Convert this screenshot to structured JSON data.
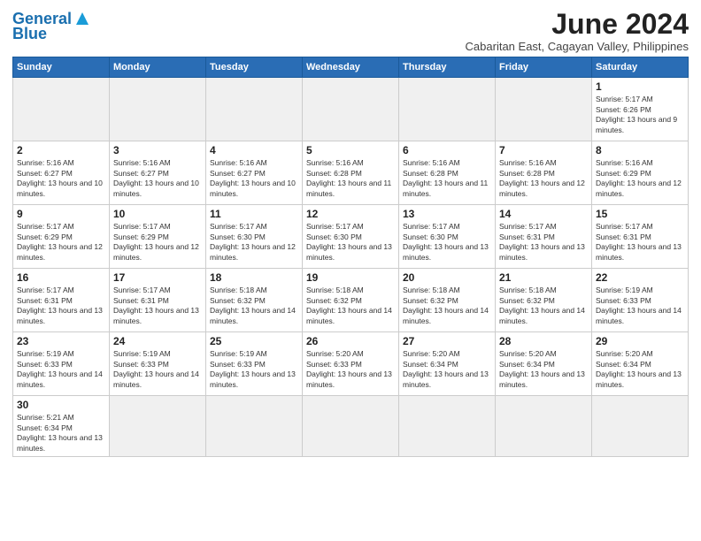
{
  "logo": {
    "text_general": "General",
    "text_blue": "Blue"
  },
  "title": {
    "month_year": "June 2024",
    "location": "Cabaritan East, Cagayan Valley, Philippines"
  },
  "days_of_week": [
    "Sunday",
    "Monday",
    "Tuesday",
    "Wednesday",
    "Thursday",
    "Friday",
    "Saturday"
  ],
  "weeks": [
    [
      {
        "day": "",
        "empty": true
      },
      {
        "day": "",
        "empty": true
      },
      {
        "day": "",
        "empty": true
      },
      {
        "day": "",
        "empty": true
      },
      {
        "day": "",
        "empty": true
      },
      {
        "day": "",
        "empty": true
      },
      {
        "day": "1",
        "sunrise": "5:17 AM",
        "sunset": "6:26 PM",
        "daylight": "13 hours and 9 minutes."
      }
    ],
    [
      {
        "day": "2",
        "sunrise": "5:16 AM",
        "sunset": "6:27 PM",
        "daylight": "13 hours and 10 minutes."
      },
      {
        "day": "3",
        "sunrise": "5:16 AM",
        "sunset": "6:27 PM",
        "daylight": "13 hours and 10 minutes."
      },
      {
        "day": "4",
        "sunrise": "5:16 AM",
        "sunset": "6:27 PM",
        "daylight": "13 hours and 10 minutes."
      },
      {
        "day": "5",
        "sunrise": "5:16 AM",
        "sunset": "6:28 PM",
        "daylight": "13 hours and 11 minutes."
      },
      {
        "day": "6",
        "sunrise": "5:16 AM",
        "sunset": "6:28 PM",
        "daylight": "13 hours and 11 minutes."
      },
      {
        "day": "7",
        "sunrise": "5:16 AM",
        "sunset": "6:28 PM",
        "daylight": "13 hours and 12 minutes."
      },
      {
        "day": "8",
        "sunrise": "5:16 AM",
        "sunset": "6:29 PM",
        "daylight": "13 hours and 12 minutes."
      }
    ],
    [
      {
        "day": "9",
        "sunrise": "5:17 AM",
        "sunset": "6:29 PM",
        "daylight": "13 hours and 12 minutes."
      },
      {
        "day": "10",
        "sunrise": "5:17 AM",
        "sunset": "6:29 PM",
        "daylight": "13 hours and 12 minutes."
      },
      {
        "day": "11",
        "sunrise": "5:17 AM",
        "sunset": "6:30 PM",
        "daylight": "13 hours and 12 minutes."
      },
      {
        "day": "12",
        "sunrise": "5:17 AM",
        "sunset": "6:30 PM",
        "daylight": "13 hours and 13 minutes."
      },
      {
        "day": "13",
        "sunrise": "5:17 AM",
        "sunset": "6:30 PM",
        "daylight": "13 hours and 13 minutes."
      },
      {
        "day": "14",
        "sunrise": "5:17 AM",
        "sunset": "6:31 PM",
        "daylight": "13 hours and 13 minutes."
      },
      {
        "day": "15",
        "sunrise": "5:17 AM",
        "sunset": "6:31 PM",
        "daylight": "13 hours and 13 minutes."
      }
    ],
    [
      {
        "day": "16",
        "sunrise": "5:17 AM",
        "sunset": "6:31 PM",
        "daylight": "13 hours and 13 minutes."
      },
      {
        "day": "17",
        "sunrise": "5:17 AM",
        "sunset": "6:31 PM",
        "daylight": "13 hours and 13 minutes."
      },
      {
        "day": "18",
        "sunrise": "5:18 AM",
        "sunset": "6:32 PM",
        "daylight": "13 hours and 14 minutes."
      },
      {
        "day": "19",
        "sunrise": "5:18 AM",
        "sunset": "6:32 PM",
        "daylight": "13 hours and 14 minutes."
      },
      {
        "day": "20",
        "sunrise": "5:18 AM",
        "sunset": "6:32 PM",
        "daylight": "13 hours and 14 minutes."
      },
      {
        "day": "21",
        "sunrise": "5:18 AM",
        "sunset": "6:32 PM",
        "daylight": "13 hours and 14 minutes."
      },
      {
        "day": "22",
        "sunrise": "5:19 AM",
        "sunset": "6:33 PM",
        "daylight": "13 hours and 14 minutes."
      }
    ],
    [
      {
        "day": "23",
        "sunrise": "5:19 AM",
        "sunset": "6:33 PM",
        "daylight": "13 hours and 14 minutes."
      },
      {
        "day": "24",
        "sunrise": "5:19 AM",
        "sunset": "6:33 PM",
        "daylight": "13 hours and 14 minutes."
      },
      {
        "day": "25",
        "sunrise": "5:19 AM",
        "sunset": "6:33 PM",
        "daylight": "13 hours and 13 minutes."
      },
      {
        "day": "26",
        "sunrise": "5:20 AM",
        "sunset": "6:33 PM",
        "daylight": "13 hours and 13 minutes."
      },
      {
        "day": "27",
        "sunrise": "5:20 AM",
        "sunset": "6:34 PM",
        "daylight": "13 hours and 13 minutes."
      },
      {
        "day": "28",
        "sunrise": "5:20 AM",
        "sunset": "6:34 PM",
        "daylight": "13 hours and 13 minutes."
      },
      {
        "day": "29",
        "sunrise": "5:20 AM",
        "sunset": "6:34 PM",
        "daylight": "13 hours and 13 minutes."
      }
    ],
    [
      {
        "day": "30",
        "sunrise": "5:21 AM",
        "sunset": "6:34 PM",
        "daylight": "13 hours and 13 minutes."
      },
      {
        "day": "",
        "empty": true
      },
      {
        "day": "",
        "empty": true
      },
      {
        "day": "",
        "empty": true
      },
      {
        "day": "",
        "empty": true
      },
      {
        "day": "",
        "empty": true
      },
      {
        "day": "",
        "empty": true
      }
    ]
  ]
}
